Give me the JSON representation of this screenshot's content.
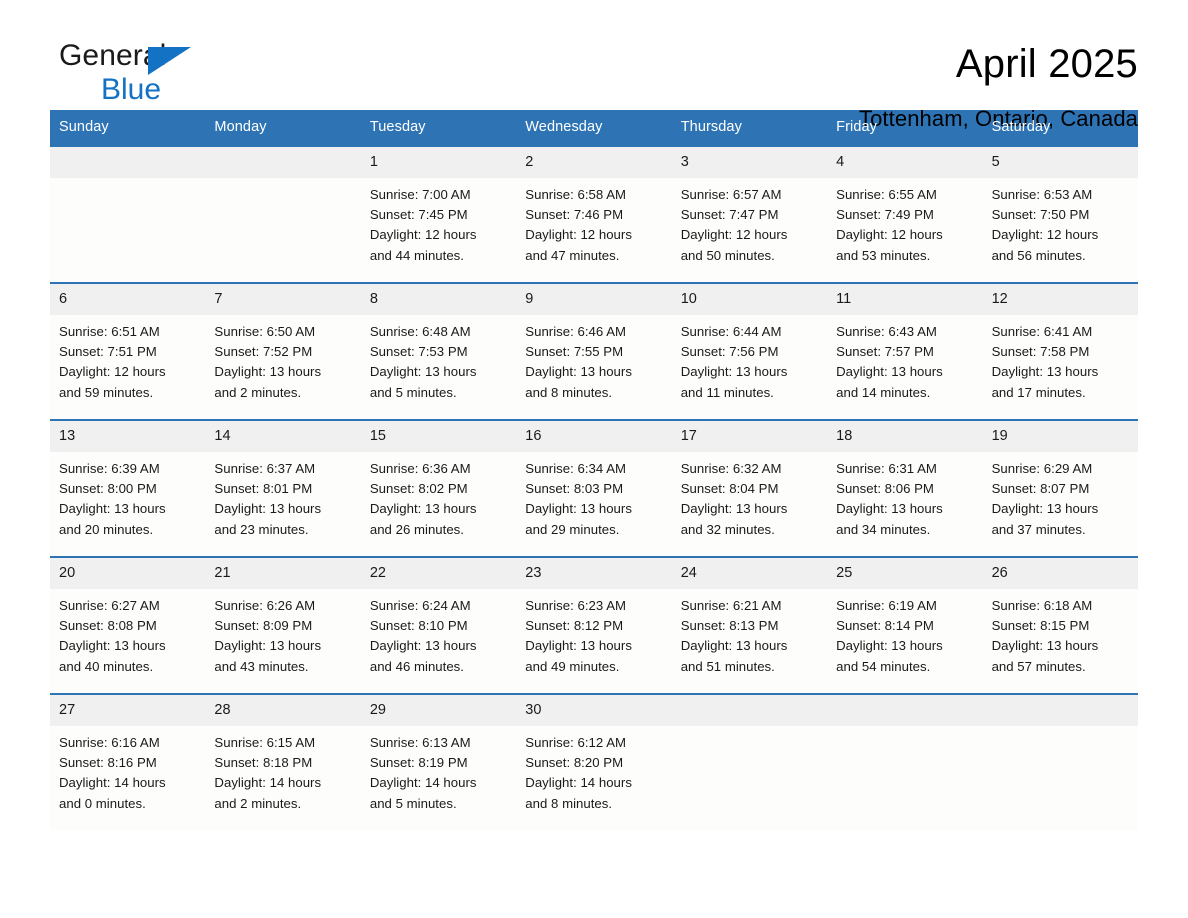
{
  "brand": {
    "name_part1": "General",
    "name_part2": "Blue",
    "triangle_icon": "blue-triangle-icon",
    "accent_color": "#1372c4"
  },
  "header": {
    "title": "April 2025",
    "location": "Tottenham, Ontario, Canada"
  },
  "theme": {
    "header_blue": "#2e74b5",
    "date_band_gray": "#f0f0f0",
    "cell_background": "#fdfdfc",
    "text_color": "#1a1a1a"
  },
  "weekdays": [
    "Sunday",
    "Monday",
    "Tuesday",
    "Wednesday",
    "Thursday",
    "Friday",
    "Saturday"
  ],
  "weeks": [
    {
      "days": [
        {
          "num": "",
          "text": ""
        },
        {
          "num": "",
          "text": ""
        },
        {
          "num": "1",
          "text": "Sunrise: 7:00 AM\nSunset: 7:45 PM\nDaylight: 12 hours\nand 44 minutes."
        },
        {
          "num": "2",
          "text": "Sunrise: 6:58 AM\nSunset: 7:46 PM\nDaylight: 12 hours\nand 47 minutes."
        },
        {
          "num": "3",
          "text": "Sunrise: 6:57 AM\nSunset: 7:47 PM\nDaylight: 12 hours\nand 50 minutes."
        },
        {
          "num": "4",
          "text": "Sunrise: 6:55 AM\nSunset: 7:49 PM\nDaylight: 12 hours\nand 53 minutes."
        },
        {
          "num": "5",
          "text": "Sunrise: 6:53 AM\nSunset: 7:50 PM\nDaylight: 12 hours\nand 56 minutes."
        }
      ]
    },
    {
      "days": [
        {
          "num": "6",
          "text": "Sunrise: 6:51 AM\nSunset: 7:51 PM\nDaylight: 12 hours\nand 59 minutes."
        },
        {
          "num": "7",
          "text": "Sunrise: 6:50 AM\nSunset: 7:52 PM\nDaylight: 13 hours\nand 2 minutes."
        },
        {
          "num": "8",
          "text": "Sunrise: 6:48 AM\nSunset: 7:53 PM\nDaylight: 13 hours\nand 5 minutes."
        },
        {
          "num": "9",
          "text": "Sunrise: 6:46 AM\nSunset: 7:55 PM\nDaylight: 13 hours\nand 8 minutes."
        },
        {
          "num": "10",
          "text": "Sunrise: 6:44 AM\nSunset: 7:56 PM\nDaylight: 13 hours\nand 11 minutes."
        },
        {
          "num": "11",
          "text": "Sunrise: 6:43 AM\nSunset: 7:57 PM\nDaylight: 13 hours\nand 14 minutes."
        },
        {
          "num": "12",
          "text": "Sunrise: 6:41 AM\nSunset: 7:58 PM\nDaylight: 13 hours\nand 17 minutes."
        }
      ]
    },
    {
      "days": [
        {
          "num": "13",
          "text": "Sunrise: 6:39 AM\nSunset: 8:00 PM\nDaylight: 13 hours\nand 20 minutes."
        },
        {
          "num": "14",
          "text": "Sunrise: 6:37 AM\nSunset: 8:01 PM\nDaylight: 13 hours\nand 23 minutes."
        },
        {
          "num": "15",
          "text": "Sunrise: 6:36 AM\nSunset: 8:02 PM\nDaylight: 13 hours\nand 26 minutes."
        },
        {
          "num": "16",
          "text": "Sunrise: 6:34 AM\nSunset: 8:03 PM\nDaylight: 13 hours\nand 29 minutes."
        },
        {
          "num": "17",
          "text": "Sunrise: 6:32 AM\nSunset: 8:04 PM\nDaylight: 13 hours\nand 32 minutes."
        },
        {
          "num": "18",
          "text": "Sunrise: 6:31 AM\nSunset: 8:06 PM\nDaylight: 13 hours\nand 34 minutes."
        },
        {
          "num": "19",
          "text": "Sunrise: 6:29 AM\nSunset: 8:07 PM\nDaylight: 13 hours\nand 37 minutes."
        }
      ]
    },
    {
      "days": [
        {
          "num": "20",
          "text": "Sunrise: 6:27 AM\nSunset: 8:08 PM\nDaylight: 13 hours\nand 40 minutes."
        },
        {
          "num": "21",
          "text": "Sunrise: 6:26 AM\nSunset: 8:09 PM\nDaylight: 13 hours\nand 43 minutes."
        },
        {
          "num": "22",
          "text": "Sunrise: 6:24 AM\nSunset: 8:10 PM\nDaylight: 13 hours\nand 46 minutes."
        },
        {
          "num": "23",
          "text": "Sunrise: 6:23 AM\nSunset: 8:12 PM\nDaylight: 13 hours\nand 49 minutes."
        },
        {
          "num": "24",
          "text": "Sunrise: 6:21 AM\nSunset: 8:13 PM\nDaylight: 13 hours\nand 51 minutes."
        },
        {
          "num": "25",
          "text": "Sunrise: 6:19 AM\nSunset: 8:14 PM\nDaylight: 13 hours\nand 54 minutes."
        },
        {
          "num": "26",
          "text": "Sunrise: 6:18 AM\nSunset: 8:15 PM\nDaylight: 13 hours\nand 57 minutes."
        }
      ]
    },
    {
      "days": [
        {
          "num": "27",
          "text": "Sunrise: 6:16 AM\nSunset: 8:16 PM\nDaylight: 14 hours\nand 0 minutes."
        },
        {
          "num": "28",
          "text": "Sunrise: 6:15 AM\nSunset: 8:18 PM\nDaylight: 14 hours\nand 2 minutes."
        },
        {
          "num": "29",
          "text": "Sunrise: 6:13 AM\nSunset: 8:19 PM\nDaylight: 14 hours\nand 5 minutes."
        },
        {
          "num": "30",
          "text": "Sunrise: 6:12 AM\nSunset: 8:20 PM\nDaylight: 14 hours\nand 8 minutes."
        },
        {
          "num": "",
          "text": ""
        },
        {
          "num": "",
          "text": ""
        },
        {
          "num": "",
          "text": ""
        }
      ]
    }
  ]
}
